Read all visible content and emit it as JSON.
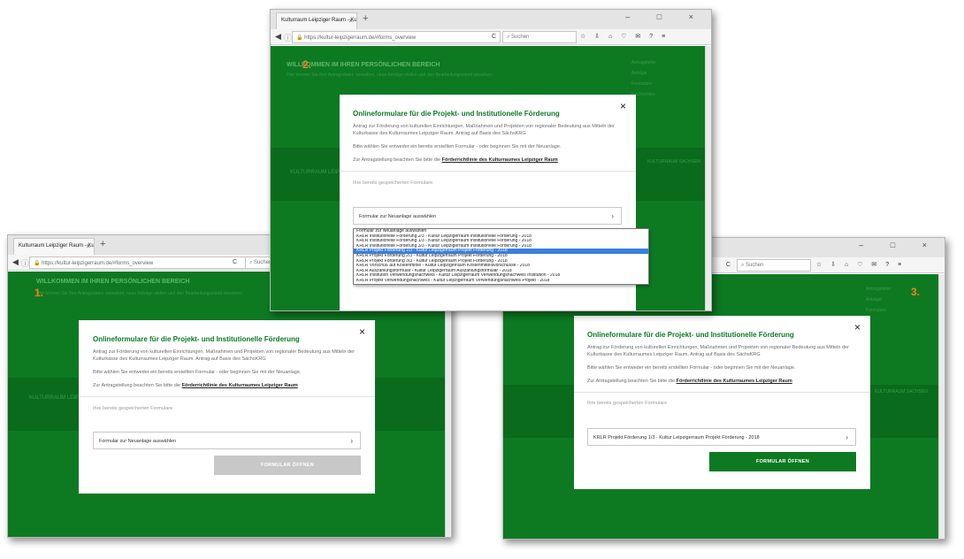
{
  "browser": {
    "tab_title": "Kulturraum Leipziger Raum - Ku",
    "tab_close": "×",
    "new_tab": "+",
    "url": "https://kultur-leipzigerraum.de/#forms_overview",
    "search_placeholder": "Suchen",
    "window_controls": "– □ ×"
  },
  "page": {
    "welcome": "WILLKOMMEN IM IHREN PERSÖNLICHEN BEREICH",
    "welcome_text": "Hier können Sie Ihre Antragsdaten verwalten, neue Anträge stellen und den Bearbeitungsstand einsehen.",
    "menu_items": [
      "Antragsteller",
      "Anträge",
      "Formulare",
      "Nachrichten",
      "Abmelden"
    ],
    "logo_text": "KULTURRAUM LEIPZIGER RAUM",
    "logo_right": "KULTURRAUM SACHSEN"
  },
  "steps": {
    "s1": "1.",
    "s2": "2.",
    "s3": "3."
  },
  "modal": {
    "title": "Onlineformulare für die Projekt- und Institutionelle Förderung",
    "intro": "Antrag zur Förderung von kulturellen Einrichtungen, Maßnahmen und Projekten von regionaler Bedeutung aus Mitteln der Kulturkasse des Kulturraumes Leipziger Raum. Antrag auf Basis des SächsKRG",
    "choose": "Bitte wählen Sie entweder ein bereits erstellten Formular - oder beginnen Sie mit der Neuanlage.",
    "hint_prefix": "Zur Antragstellung beachten Sie bitte die ",
    "hint_link": "Förderrichtlinie des Kulturraumes Leipziger Raum",
    "saved_label": "Ihre bereits gespeicherten Formulare",
    "close": "×",
    "open_button": "FORMULAR ÖFFNEN"
  },
  "select": {
    "default_value": "Formular zur Neuanlage auswählen",
    "selected_value": "KRLR Projekt Förderung 1/3 - Kultur Leipzigerraum Projekt Förderung - 2018",
    "selected_index": 4,
    "options": [
      "Formular zur Neuanlage auswählen",
      "KRLR Institutionelle Förderung 2/3 - Kultur Leipzigerraum Institutionelle Förderung - 2018",
      "KRLR Institutionelle Förderung 1/3 - Kultur Leipzigerraum Institutionelle Förderung - 2018",
      "KRLR Institutionelle Förderung 3/3 - Kultur Leipzigerraum Institutionelle Förderung - 2018",
      "KRLR Projekt Förderung 1/3 - Kultur Leipzigerraum Projekt Förderung - 2018",
      "KRLR Projekt Förderung 2/3 - Kultur Leipzigerraum Projekt Förderung - 2018",
      "KRLR Projekt Förderung 3/3 - Kultur Leipzigerraum Projekt Förderung - 2018",
      "KRLR Vorschuß auf Kostenmittel - Kultur Leipzigerraum Kostenmittelsvorschüsse - 2018",
      "KRLR Auszahlungsformular - Kultur Leipzigerraum Auszahlungsformular - 2018",
      "KRLR Institution Verwendungsnachweis - Kultur Leipzigerraum Verwendungsnachweis Institution - 2018",
      "KRLR Projekt Verwendungsnachweis - Kultur Leipzigerraum Verwendungsnachweis Projekt - 2018"
    ]
  },
  "colors": {
    "brand_green": "#0d7a22",
    "disabled_button": "#c8c8c8",
    "step_orange": "#ff7a1a",
    "highlight": "#3b7fdb"
  }
}
